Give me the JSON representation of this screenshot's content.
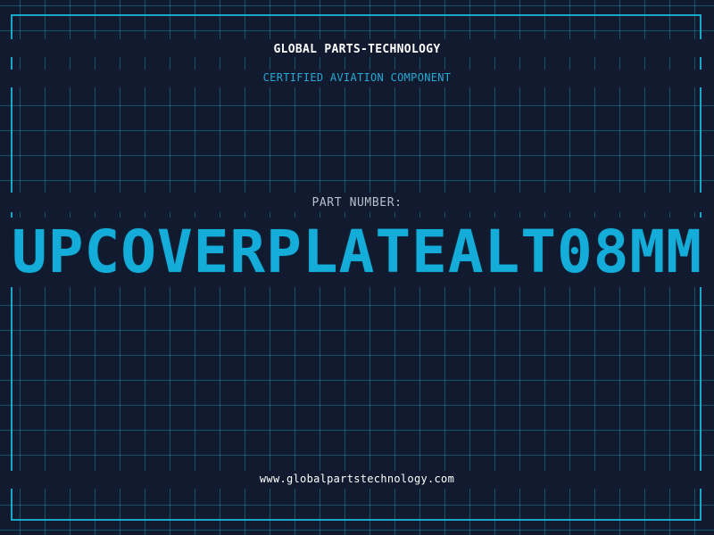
{
  "header": {
    "brand": "GLOBAL PARTS-TECHNOLOGY",
    "subtitle": "CERTIFIED AVIATION COMPONENT"
  },
  "part": {
    "label": "PART NUMBER:",
    "number": "UPCOVERPLATEALT08MM"
  },
  "footer": {
    "website": "www.globalpartstechnology.com"
  },
  "colors": {
    "background": "#111a2e",
    "grid": "#1e96af",
    "accent": "#14acd8",
    "label": "#b6bfcc",
    "text": "#ffffff"
  }
}
